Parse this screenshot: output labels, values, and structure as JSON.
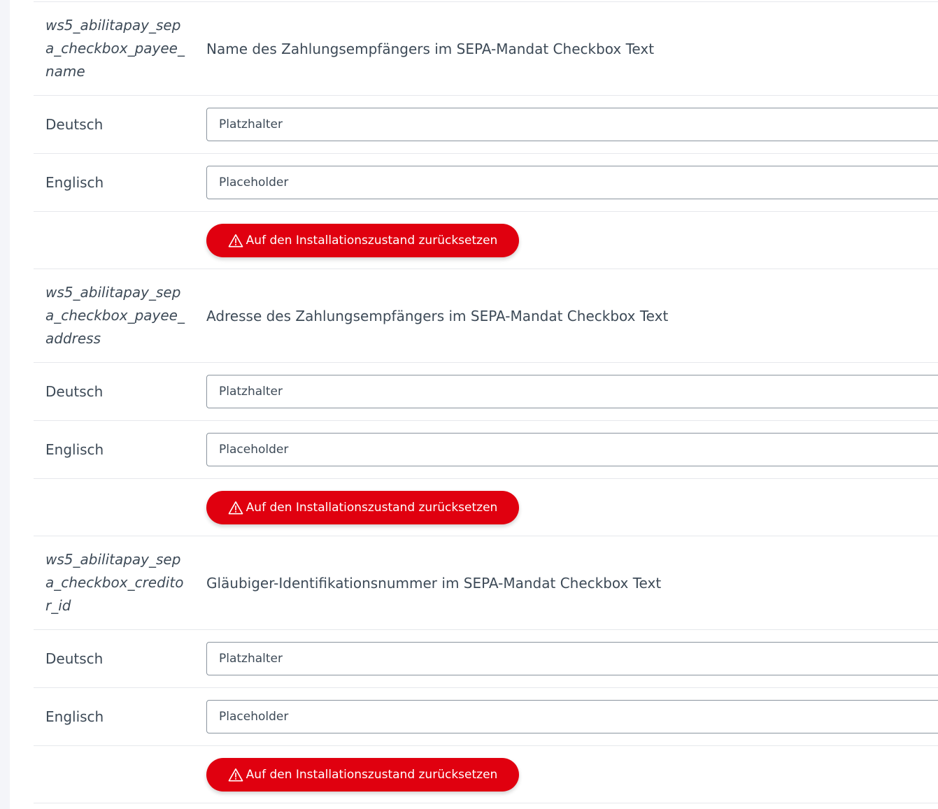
{
  "settings": [
    {
      "key": "ws5_abilitapay_sepa_checkbox_payee_name",
      "description": "Name des Zahlungsempfängers im SEPA-Mandat Checkbox Text",
      "languages": [
        {
          "label": "Deutsch",
          "placeholder": "Platzhalter",
          "value": ""
        },
        {
          "label": "Englisch",
          "placeholder": "Placeholder",
          "value": ""
        }
      ],
      "reset_label": "Auf den Installationszustand zurücksetzen"
    },
    {
      "key": "ws5_abilitapay_sepa_checkbox_payee_address",
      "description": "Adresse des Zahlungsempfängers im SEPA-Mandat Checkbox Text",
      "languages": [
        {
          "label": "Deutsch",
          "placeholder": "Platzhalter",
          "value": ""
        },
        {
          "label": "Englisch",
          "placeholder": "Placeholder",
          "value": ""
        }
      ],
      "reset_label": "Auf den Installationszustand zurücksetzen"
    },
    {
      "key": "ws5_abilitapay_sepa_checkbox_creditor_id",
      "description": "Gläubiger-Identifikationsnummer im SEPA-Mandat Checkbox Text",
      "languages": [
        {
          "label": "Deutsch",
          "placeholder": "Platzhalter",
          "value": ""
        },
        {
          "label": "Englisch",
          "placeholder": "Placeholder",
          "value": ""
        }
      ],
      "reset_label": "Auf den Installationszustand zurücksetzen"
    }
  ],
  "colors": {
    "accent": "#e0000f",
    "text": "#3d4a57",
    "border": "#e6e8ec"
  },
  "icons": {
    "reset": "warning-triangle-icon"
  }
}
